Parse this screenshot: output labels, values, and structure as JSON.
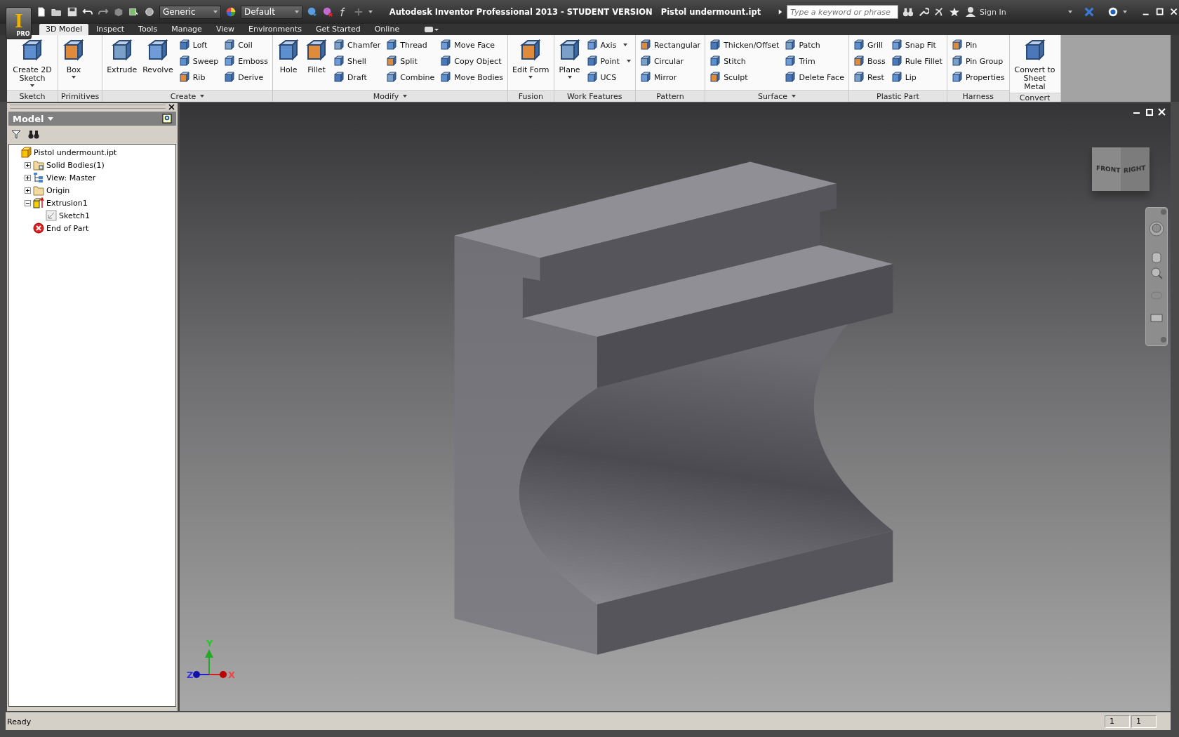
{
  "app": {
    "logo_letter": "I",
    "edition": "PRO",
    "title": "Autodesk Inventor Professional 2013 - STUDENT VERSION",
    "document": "Pistol undermount.ipt"
  },
  "quick_access": {
    "material": "Generic",
    "appearance": "Default"
  },
  "search": {
    "placeholder": "Type a keyword or phrase"
  },
  "sign_in": "Sign In",
  "tabs": [
    {
      "label": "3D Model",
      "selected": true
    },
    {
      "label": "Inspect",
      "selected": false
    },
    {
      "label": "Tools",
      "selected": false
    },
    {
      "label": "Manage",
      "selected": false
    },
    {
      "label": "View",
      "selected": false
    },
    {
      "label": "Environments",
      "selected": false
    },
    {
      "label": "Get Started",
      "selected": false
    },
    {
      "label": "Online",
      "selected": false
    }
  ],
  "ribbon": [
    {
      "title": "Sketch",
      "menu": false,
      "columns": [
        {
          "kind": "large",
          "items": [
            {
              "label": "Create 2D Sketch",
              "menu": true
            }
          ]
        }
      ]
    },
    {
      "title": "Primitives",
      "menu": false,
      "columns": [
        {
          "kind": "large",
          "items": [
            {
              "label": "Box",
              "menu": true
            }
          ]
        }
      ]
    },
    {
      "title": "Create",
      "menu": true,
      "columns": [
        {
          "kind": "large",
          "items": [
            {
              "label": "Extrude",
              "menu": false
            }
          ]
        },
        {
          "kind": "large",
          "items": [
            {
              "label": "Revolve",
              "menu": false
            }
          ]
        },
        {
          "kind": "stack",
          "items": [
            {
              "label": "Loft",
              "menu": false
            },
            {
              "label": "Sweep",
              "menu": false
            },
            {
              "label": "Rib",
              "menu": false
            }
          ]
        },
        {
          "kind": "stack",
          "items": [
            {
              "label": "Coil",
              "menu": false
            },
            {
              "label": "Emboss",
              "menu": false
            },
            {
              "label": "Derive",
              "menu": false
            }
          ]
        }
      ]
    },
    {
      "title": "Modify",
      "menu": true,
      "columns": [
        {
          "kind": "large",
          "items": [
            {
              "label": "Hole",
              "menu": false
            }
          ]
        },
        {
          "kind": "large",
          "items": [
            {
              "label": "Fillet",
              "menu": false
            }
          ]
        },
        {
          "kind": "stack",
          "items": [
            {
              "label": "Chamfer",
              "menu": false
            },
            {
              "label": "Shell",
              "menu": false
            },
            {
              "label": "Draft",
              "menu": false
            }
          ]
        },
        {
          "kind": "stack",
          "items": [
            {
              "label": "Thread",
              "menu": false
            },
            {
              "label": "Split",
              "menu": false
            },
            {
              "label": "Combine",
              "menu": false
            }
          ]
        },
        {
          "kind": "stack",
          "items": [
            {
              "label": "Move Face",
              "menu": false
            },
            {
              "label": "Copy Object",
              "menu": false
            },
            {
              "label": "Move Bodies",
              "menu": false
            }
          ]
        }
      ]
    },
    {
      "title": "Fusion",
      "menu": false,
      "columns": [
        {
          "kind": "large",
          "items": [
            {
              "label": "Edit Form",
              "menu": true
            }
          ]
        }
      ]
    },
    {
      "title": "Work Features",
      "menu": false,
      "columns": [
        {
          "kind": "large",
          "items": [
            {
              "label": "Plane",
              "menu": true
            }
          ]
        },
        {
          "kind": "stack",
          "items": [
            {
              "label": "Axis",
              "menu": true
            },
            {
              "label": "Point",
              "menu": true
            },
            {
              "label": "UCS",
              "menu": false
            }
          ]
        }
      ]
    },
    {
      "title": "Pattern",
      "menu": false,
      "columns": [
        {
          "kind": "stack",
          "items": [
            {
              "label": "Rectangular",
              "menu": false
            },
            {
              "label": "Circular",
              "menu": false
            },
            {
              "label": "Mirror",
              "menu": false
            }
          ]
        }
      ]
    },
    {
      "title": "Surface",
      "menu": true,
      "columns": [
        {
          "kind": "stack",
          "items": [
            {
              "label": "Thicken/Offset",
              "menu": false
            },
            {
              "label": "Stitch",
              "menu": false
            },
            {
              "label": "Sculpt",
              "menu": false
            }
          ]
        },
        {
          "kind": "stack",
          "items": [
            {
              "label": "Patch",
              "menu": false
            },
            {
              "label": "Trim",
              "menu": false
            },
            {
              "label": "Delete Face",
              "menu": false
            }
          ]
        }
      ]
    },
    {
      "title": "Plastic Part",
      "menu": false,
      "columns": [
        {
          "kind": "stack",
          "items": [
            {
              "label": "Grill",
              "menu": false
            },
            {
              "label": "Boss",
              "menu": false
            },
            {
              "label": "Rest",
              "menu": false
            }
          ]
        },
        {
          "kind": "stack",
          "items": [
            {
              "label": "Snap Fit",
              "menu": false
            },
            {
              "label": "Rule Fillet",
              "menu": false
            },
            {
              "label": "Lip",
              "menu": false
            }
          ]
        }
      ]
    },
    {
      "title": "Harness",
      "menu": false,
      "columns": [
        {
          "kind": "stack",
          "items": [
            {
              "label": "Pin",
              "menu": false
            },
            {
              "label": "Pin Group",
              "menu": false
            },
            {
              "label": "Properties",
              "menu": false
            }
          ]
        }
      ]
    },
    {
      "title": "Convert",
      "menu": false,
      "columns": [
        {
          "kind": "large",
          "items": [
            {
              "label": "Convert to Sheet Metal",
              "menu": false
            }
          ]
        }
      ]
    }
  ],
  "browser": {
    "title": "Model",
    "tree": [
      {
        "label": "Pistol undermount.ipt",
        "kind": "part",
        "children": [
          {
            "label": "Solid Bodies(1)",
            "kind": "bodies",
            "expanded": false
          },
          {
            "label": "View: Master",
            "kind": "view",
            "expanded": false
          },
          {
            "label": "Origin",
            "kind": "folder",
            "expanded": false
          },
          {
            "label": "Extrusion1",
            "kind": "extrusion",
            "expanded": true,
            "children": [
              {
                "label": "Sketch1",
                "kind": "sketch"
              }
            ]
          },
          {
            "label": "End of Part",
            "kind": "end"
          }
        ]
      }
    ]
  },
  "viewcube": {
    "front": "FRONT",
    "right": "RIGHT"
  },
  "triad": {
    "y": "Y",
    "z": "Z",
    "x": "X"
  },
  "status_bar": {
    "message": "Ready",
    "field_1": "1",
    "field_2": "1"
  }
}
